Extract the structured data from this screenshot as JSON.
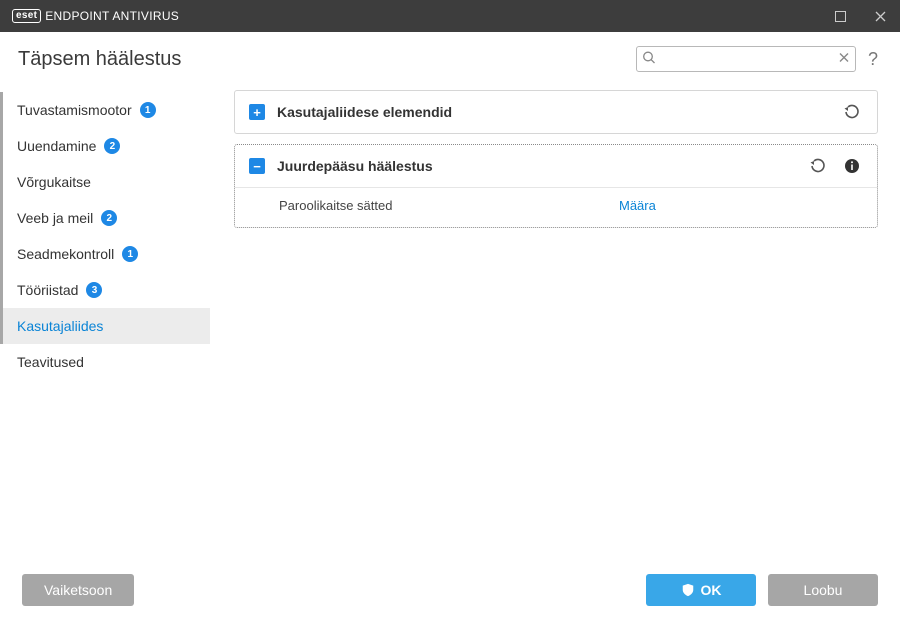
{
  "titlebar": {
    "logo_text": "eset",
    "product": "ENDPOINT ANTIVIRUS"
  },
  "header": {
    "title": "Täpsem häälestus",
    "search_placeholder": "",
    "help": "?"
  },
  "sidebar": {
    "items": [
      {
        "label": "Tuvastamismootor",
        "badge": "1"
      },
      {
        "label": "Uuendamine",
        "badge": "2"
      },
      {
        "label": "Võrgukaitse",
        "badge": ""
      },
      {
        "label": "Veeb ja meil",
        "badge": "2"
      },
      {
        "label": "Seadmekontroll",
        "badge": "1"
      },
      {
        "label": "Tööriistad",
        "badge": "3"
      },
      {
        "label": "Kasutajaliides",
        "badge": ""
      },
      {
        "label": "Teavitused",
        "badge": ""
      }
    ]
  },
  "panels": {
    "ui_elements": {
      "title": "Kasutajaliidese elemendid"
    },
    "access_setup": {
      "title": "Juurdepääsu häälestus",
      "row_key": "Paroolikaitse sätted",
      "row_val": "Määra"
    }
  },
  "footer": {
    "default": "Vaiketsoon",
    "ok": "OK",
    "cancel": "Loobu"
  }
}
